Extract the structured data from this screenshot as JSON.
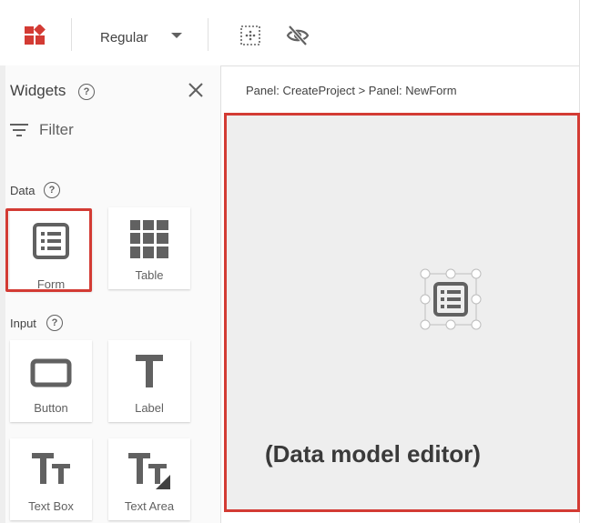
{
  "toolbar": {
    "size_select": {
      "value": "Regular"
    },
    "icons": [
      "app-logo-icon",
      "grid-toggle-icon",
      "visibility-off-icon"
    ]
  },
  "widgets_panel": {
    "title": "Widgets",
    "filter_label": "Filter",
    "sections": [
      {
        "label": "Data",
        "items": [
          {
            "label": "Form",
            "icon": "form-icon",
            "highlighted": true
          },
          {
            "label": "Table",
            "icon": "table-icon"
          }
        ]
      },
      {
        "label": "Input",
        "items": [
          {
            "label": "Button",
            "icon": "button-icon"
          },
          {
            "label": "Label",
            "icon": "label-icon"
          },
          {
            "label": "Text Box",
            "icon": "text-box-icon"
          },
          {
            "label": "Text Area",
            "icon": "text-area-icon"
          }
        ]
      }
    ]
  },
  "breadcrumb": "Panel: CreateProject > Panel: NewForm",
  "canvas": {
    "caption": "(Data model editor)",
    "selected_icon": "form-icon"
  },
  "colors": {
    "highlight": "#d33b34",
    "logo": "#d33b34",
    "canvas_bg": "#eeeeee",
    "icon_gray": "#616161"
  }
}
